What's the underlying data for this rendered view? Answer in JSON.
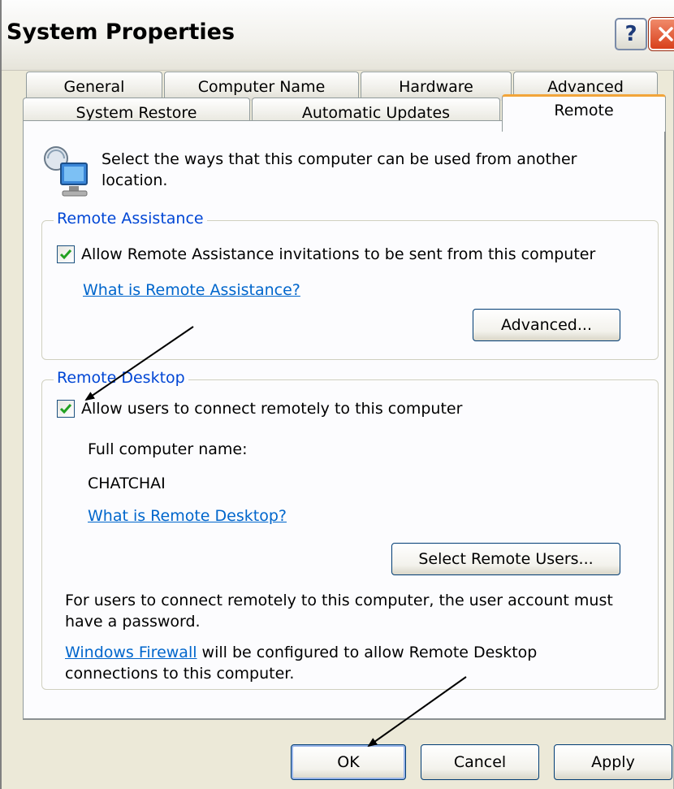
{
  "window": {
    "title": "System Properties"
  },
  "tabs": {
    "row_back": [
      "General",
      "Computer Name",
      "Hardware",
      "Advanced"
    ],
    "row_front": [
      "System Restore",
      "Automatic Updates",
      "Remote"
    ],
    "selected": "Remote"
  },
  "panel": {
    "intro": "Select the ways that this computer can be used from another location.",
    "remote_assistance": {
      "label": "Remote Assistance",
      "checkbox_label": "Allow Remote Assistance invitations to be sent from this computer",
      "checked": true,
      "help_link": "What is Remote Assistance?",
      "advanced_button": "Advanced..."
    },
    "remote_desktop": {
      "label": "Remote Desktop",
      "checkbox_label": "Allow users to connect remotely to this computer",
      "checked": true,
      "full_name_label": "Full computer name:",
      "computer_name": "CHATCHAI",
      "help_link": "What is Remote Desktop?",
      "select_users_button": "Select Remote Users...",
      "password_note": "For users to connect remotely to this computer, the user account must have a password.",
      "firewall_link": "Windows Firewall",
      "firewall_note": " will be configured to allow Remote Desktop connections to this computer."
    }
  },
  "buttons": {
    "ok": "OK",
    "cancel": "Cancel",
    "apply": "Apply"
  }
}
